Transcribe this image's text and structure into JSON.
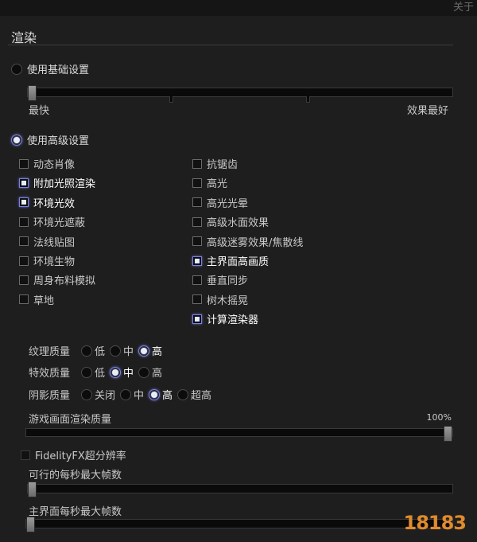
{
  "header": {
    "about_label": "关于"
  },
  "section": {
    "title": "渲染"
  },
  "basic": {
    "label": "使用基础设置",
    "selected": false,
    "slider": {
      "min_label": "最快",
      "max_label": "效果最好",
      "value_fraction": 0.0
    }
  },
  "advanced": {
    "label": "使用高级设置",
    "selected": true,
    "left_options": [
      {
        "label": "动态肖像",
        "checked": false
      },
      {
        "label": "附加光照渲染",
        "checked": true
      },
      {
        "label": "环境光效",
        "checked": true
      },
      {
        "label": "环境光遮蔽",
        "checked": false
      },
      {
        "label": "法线贴图",
        "checked": false
      },
      {
        "label": "环境生物",
        "checked": false
      },
      {
        "label": "周身布料模拟",
        "checked": false
      },
      {
        "label": "草地",
        "checked": false
      }
    ],
    "right_options": [
      {
        "label": "抗锯齿",
        "checked": false
      },
      {
        "label": "高光",
        "checked": false
      },
      {
        "label": "高光光晕",
        "checked": false
      },
      {
        "label": "高级水面效果",
        "checked": false
      },
      {
        "label": "高级迷雾效果/焦散线",
        "checked": false
      },
      {
        "label": "主界面高画质",
        "checked": true
      },
      {
        "label": "垂直同步",
        "checked": false
      },
      {
        "label": "树木摇晃",
        "checked": false
      },
      {
        "label": "计算渲染器",
        "checked": true
      }
    ]
  },
  "quality": {
    "texture": {
      "label": "纹理质量",
      "options": [
        "低",
        "中",
        "高"
      ],
      "selected": "高"
    },
    "effects": {
      "label": "特效质量",
      "options": [
        "低",
        "中",
        "高"
      ],
      "selected": "中"
    },
    "shadow": {
      "label": "阴影质量",
      "options": [
        "关闭",
        "中",
        "高",
        "超高"
      ],
      "selected": "高"
    }
  },
  "render_quality": {
    "label": "游戏画面渲染质量",
    "value_text": "100%",
    "value_fraction": 1.0
  },
  "fidelityfx": {
    "label": "FidelityFX超分辨率",
    "checked": false,
    "disabled": true
  },
  "max_fps": {
    "label": "可行的每秒最大帧数",
    "value_fraction": 0.0,
    "disabled": true
  },
  "menu_fps": {
    "label": "主界面每秒最大帧数",
    "value_fraction": 0.0
  },
  "watermark": {
    "text": "18183"
  }
}
